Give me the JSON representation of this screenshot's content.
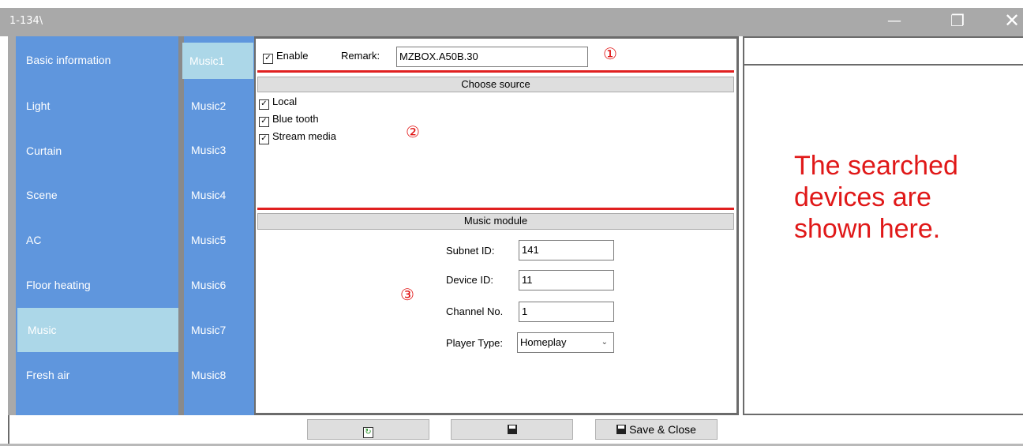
{
  "window": {
    "title": "1-134\\",
    "minimize_glyph": "—",
    "maximize_glyph": "❐",
    "close_glyph": "✕"
  },
  "nav": {
    "items": [
      {
        "label": "Basic information"
      },
      {
        "label": "Light"
      },
      {
        "label": "Curtain"
      },
      {
        "label": "Scene"
      },
      {
        "label": "AC"
      },
      {
        "label": "Floor heating"
      },
      {
        "label": "Music",
        "active": true
      },
      {
        "label": "Fresh air"
      }
    ]
  },
  "music_nav": {
    "items": [
      {
        "label": "Music1",
        "active": true
      },
      {
        "label": "Music2"
      },
      {
        "label": "Music3"
      },
      {
        "label": "Music4"
      },
      {
        "label": "Music5"
      },
      {
        "label": "Music6"
      },
      {
        "label": "Music7"
      },
      {
        "label": "Music8"
      }
    ]
  },
  "top_row": {
    "enable_label": "Enable",
    "enable_checked": true,
    "remark_label": "Remark:",
    "remark_value": "MZBOX.A50B.30",
    "marker": "①"
  },
  "source": {
    "header": "Choose source",
    "marker": "②",
    "options": [
      {
        "label": "Local",
        "checked": true
      },
      {
        "label": "Blue tooth",
        "checked": true
      },
      {
        "label": "Stream media",
        "checked": true
      }
    ]
  },
  "module": {
    "header": "Music module",
    "marker": "③",
    "subnet_label": "Subnet ID:",
    "subnet_value": "141",
    "device_label": "Device ID:",
    "device_value": "11",
    "channel_label": "Channel No.",
    "channel_value": "1",
    "player_label": "Player Type:",
    "player_value": "Homeplay"
  },
  "right_panel": {
    "text": "The searched devices are shown here."
  },
  "bottom": {
    "save_close_label": "Save & Close"
  },
  "colors": {
    "nav_bg": "#5f96dd",
    "nav_active": "#acd7e8",
    "accent_red": "#e01818"
  }
}
